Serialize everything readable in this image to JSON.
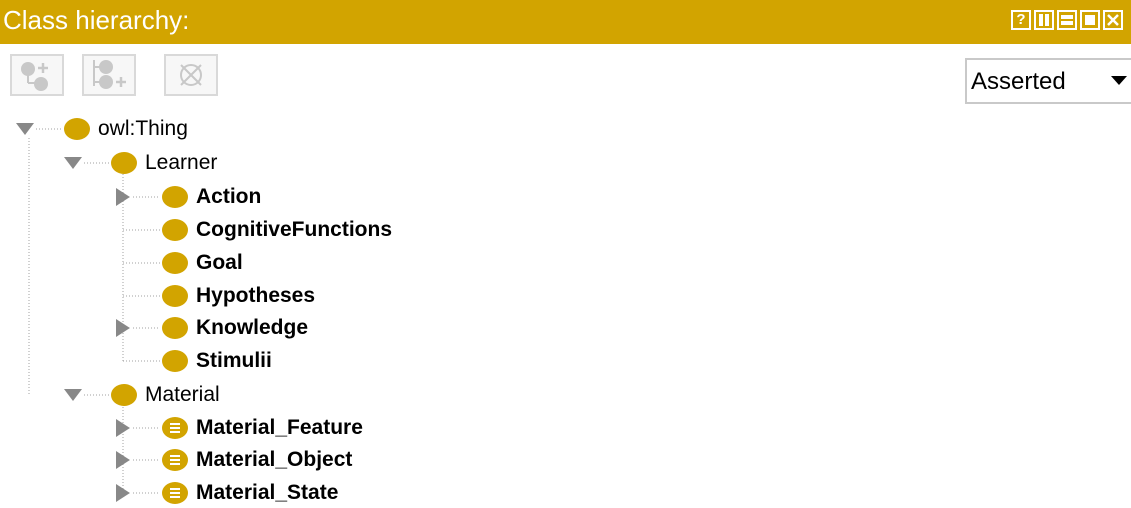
{
  "header": {
    "title": "Class hierarchy:",
    "controls": [
      {
        "name": "help",
        "label": "?"
      },
      {
        "name": "split-vertical"
      },
      {
        "name": "split-horizontal"
      },
      {
        "name": "maximize"
      },
      {
        "name": "close"
      }
    ]
  },
  "toolbar": {
    "buttons": [
      {
        "name": "add-subclass",
        "icon": "add-subclass-icon",
        "enabled": false
      },
      {
        "name": "add-sibling",
        "icon": "add-sibling-icon",
        "enabled": false
      },
      {
        "name": "delete-class",
        "icon": "delete-class-icon",
        "enabled": false
      }
    ],
    "mode_select": {
      "value": "Asserted"
    }
  },
  "colors": {
    "accent": "#d2a400",
    "tree_line": "#a0a0a0",
    "toggle": "#888888"
  },
  "tree": {
    "root": {
      "label": "owl:Thing",
      "expanded": true
    },
    "learner": {
      "label": "Learner",
      "expanded": true
    },
    "action": {
      "label": "Action",
      "expanded": false
    },
    "cognitive": {
      "label": "CognitiveFunctions"
    },
    "goal": {
      "label": "Goal"
    },
    "hypotheses": {
      "label": "Hypotheses"
    },
    "knowledge": {
      "label": "Knowledge",
      "expanded": false
    },
    "stimulii": {
      "label": "Stimulii"
    },
    "material": {
      "label": "Material",
      "expanded": true
    },
    "material_feature": {
      "label": "Material_Feature",
      "expanded": false,
      "defined": true
    },
    "material_object": {
      "label": "Material_Object",
      "expanded": false,
      "defined": true
    },
    "material_state": {
      "label": "Material_State",
      "expanded": false,
      "defined": true
    }
  }
}
